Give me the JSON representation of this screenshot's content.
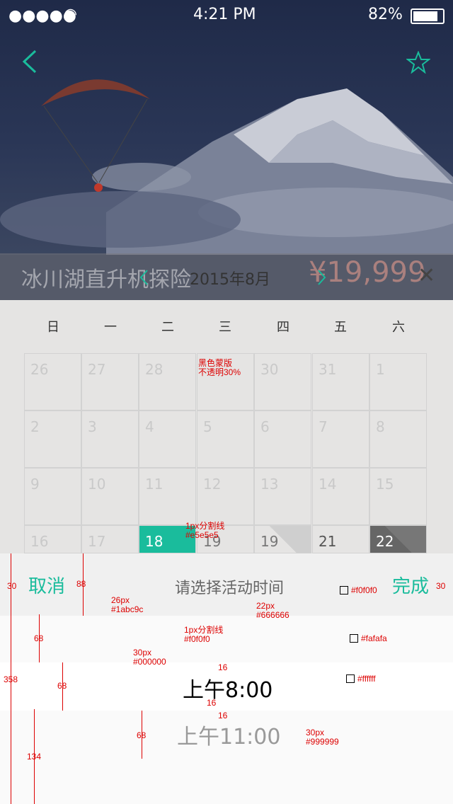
{
  "status_bar": {
    "time": "4:21 PM",
    "battery": "82%"
  },
  "trip": {
    "title": "冰川湖直升机探险",
    "price": "¥19,999"
  },
  "calendar": {
    "month": "2015年8月",
    "weekdays": [
      "日",
      "一",
      "二",
      "三",
      "四",
      "五",
      "六"
    ],
    "days": [
      "26",
      "27",
      "28",
      "30",
      "31",
      "1",
      "2",
      "3",
      "4",
      "5",
      "6",
      "7",
      "8",
      "9",
      "10",
      "11",
      "12",
      "13",
      "14",
      "15",
      "16",
      "17",
      "18",
      "19",
      "19",
      "21",
      "22"
    ]
  },
  "picker": {
    "cancel": "取消",
    "title": "请选择活动时间",
    "done": "完成",
    "selected_time": "上午8:00",
    "next_time": "上午11:00"
  },
  "annotations": {
    "mask": [
      "黑色蒙版",
      "不透明30%"
    ],
    "divider1": [
      "1px分割线",
      "#e5e5e5"
    ],
    "cancel_spec": [
      "26px",
      "#1abc9c"
    ],
    "title_spec": [
      "22px",
      "#666666"
    ],
    "divider2": [
      "1px分割线",
      "#f0f0f0"
    ],
    "selected_spec": [
      "30px",
      "#000000"
    ],
    "next_spec": [
      "30px",
      "#999999"
    ],
    "swatch1": "#f0f0f0",
    "swatch2": "#fafafa",
    "swatch3": "#ffffff",
    "dims": [
      "30",
      "88",
      "30",
      "68",
      "68",
      "68",
      "134",
      "358",
      "16",
      "16",
      "16"
    ]
  },
  "colors": {
    "accent": "#1abc9c",
    "title_gray": "#666666",
    "header_bg": "#f0f0f0",
    "body_bg": "#fafafa"
  }
}
